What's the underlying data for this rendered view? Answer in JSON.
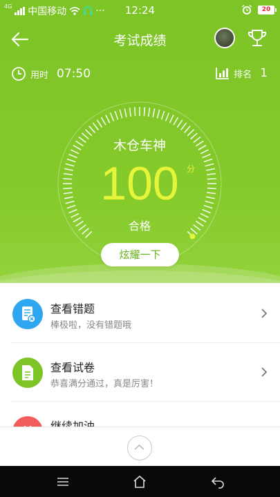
{
  "status_bar": {
    "network": "4G",
    "carrier": "中国移动",
    "extra": "···",
    "time": "12:24",
    "battery": "20"
  },
  "nav": {
    "title": "考试成绩",
    "back_icon": "arrow-left-icon",
    "trophy_icon": "trophy-icon"
  },
  "stats": {
    "time_label": "用时",
    "time_value": "07:50",
    "rank_label": "排名",
    "rank_value": "1"
  },
  "result": {
    "user_name": "木仓车神",
    "score": "100",
    "unit": "分",
    "grade": "合格",
    "progress": 1.0,
    "share_button": "炫耀一下"
  },
  "list": {
    "items": [
      {
        "title": "查看错题",
        "subtitle": "棒极啦，没有错题哦",
        "icon": "wrong-questions-doc-icon",
        "color": "#2fa6f0"
      },
      {
        "title": "查看试卷",
        "subtitle": "恭喜满分通过，真是厉害！",
        "icon": "exam-paper-doc-icon",
        "color": "#7dc426"
      },
      {
        "title": "继续加油",
        "subtitle": "",
        "icon": "gift-icon",
        "color": "#f25c5c"
      }
    ]
  },
  "colors": {
    "header_green": "#7dc426",
    "score_yellow": "#e6f53a",
    "button_text": "#68b21d"
  },
  "bottom_nav": {
    "menu_icon": "menu-icon",
    "home_icon": "home-icon",
    "back_icon": "back-arrow-icon",
    "scroll_up_icon": "chevron-up-icon"
  }
}
